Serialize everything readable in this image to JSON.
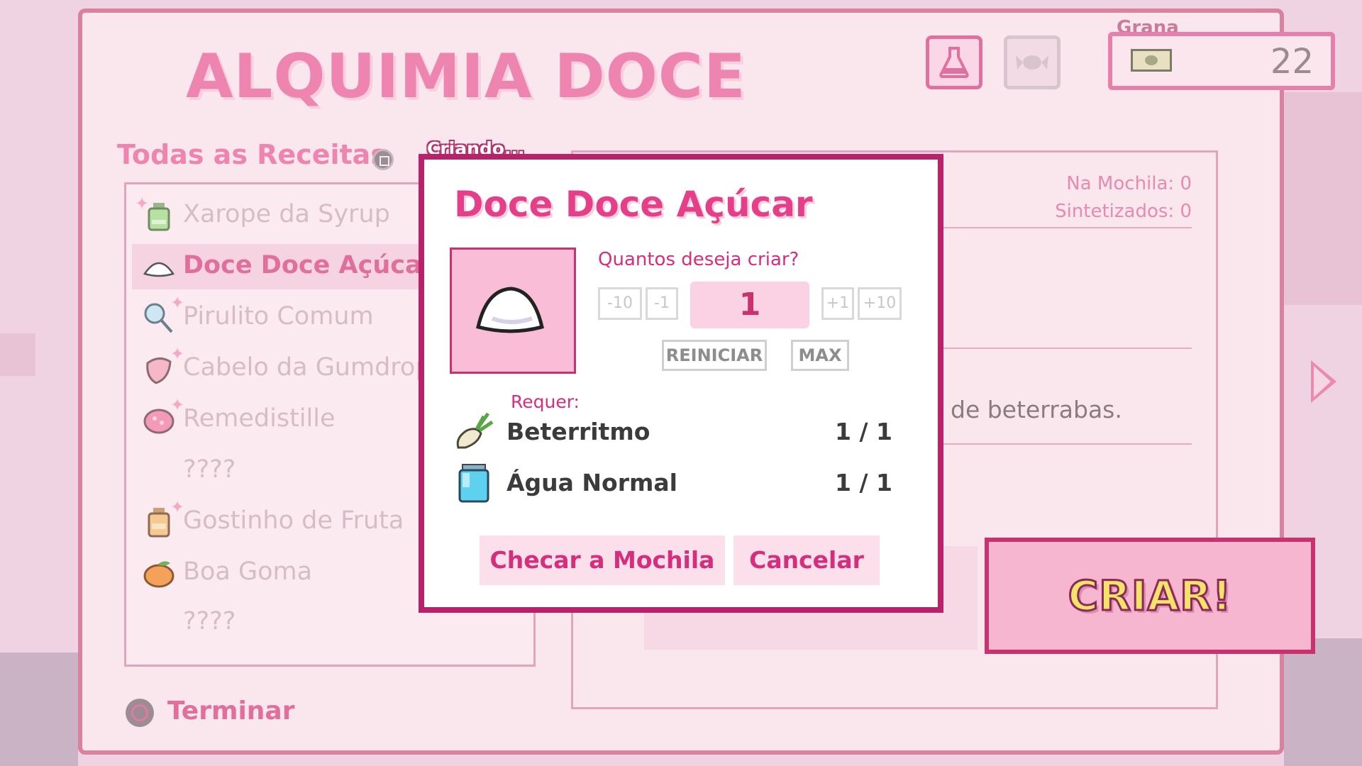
{
  "header": {
    "title": "ALQUIMIA DOCE"
  },
  "tabs": [
    {
      "icon": "flask-icon"
    },
    {
      "icon": "candy-icon"
    }
  ],
  "money": {
    "label": "Grana",
    "value": "22",
    "icon": "cash-icon"
  },
  "recipes": {
    "title": "Todas as Receitas",
    "items": [
      {
        "label": "Xarope da Syrup",
        "icon": "syrup-bottle-icon",
        "selected": false
      },
      {
        "label": "Doce Doce Açúcar",
        "icon": "sugar-pile-icon",
        "selected": true
      },
      {
        "label": "Pirulito Comum",
        "icon": "lollipop-icon",
        "selected": false
      },
      {
        "label": "Cabelo da Gumdrop",
        "icon": "gumdrop-hair-icon",
        "selected": false
      },
      {
        "label": "Remedistille",
        "icon": "remedy-icon",
        "selected": false
      },
      {
        "label": "????",
        "icon": "",
        "selected": false
      },
      {
        "label": "Gostinho de Fruta",
        "icon": "fruit-jar-icon",
        "selected": false
      },
      {
        "label": "Boa Goma",
        "icon": "orange-icon",
        "selected": false
      },
      {
        "label": "????",
        "icon": "",
        "selected": false
      }
    ]
  },
  "detail": {
    "in_bag": "Na Mochila: 0",
    "synthesized": "Sintetizados: 0",
    "description_fragment": "de beterrabas."
  },
  "create_button": "CRIAR!",
  "finish": {
    "label": "Terminar"
  },
  "modal": {
    "tag": "Criando...",
    "title": "Doce Doce Açúcar",
    "item_icon": "sugar-pile-icon",
    "quantity_question": "Quantos deseja criar?",
    "steps": {
      "minus10": "-10",
      "minus1": "-1",
      "plus1": "+1",
      "plus10": "+10"
    },
    "quantity": "1",
    "reset_label": "REINICIAR",
    "max_label": "MAX",
    "requires_label": "Requer:",
    "requirements": [
      {
        "name": "Beterritmo",
        "count": "1 / 1",
        "icon": "beet-icon"
      },
      {
        "name": "Água Normal",
        "count": "1 / 1",
        "icon": "water-jar-icon"
      }
    ],
    "check_bag_button": "Checar a Mochila",
    "cancel_button": "Cancelar"
  }
}
